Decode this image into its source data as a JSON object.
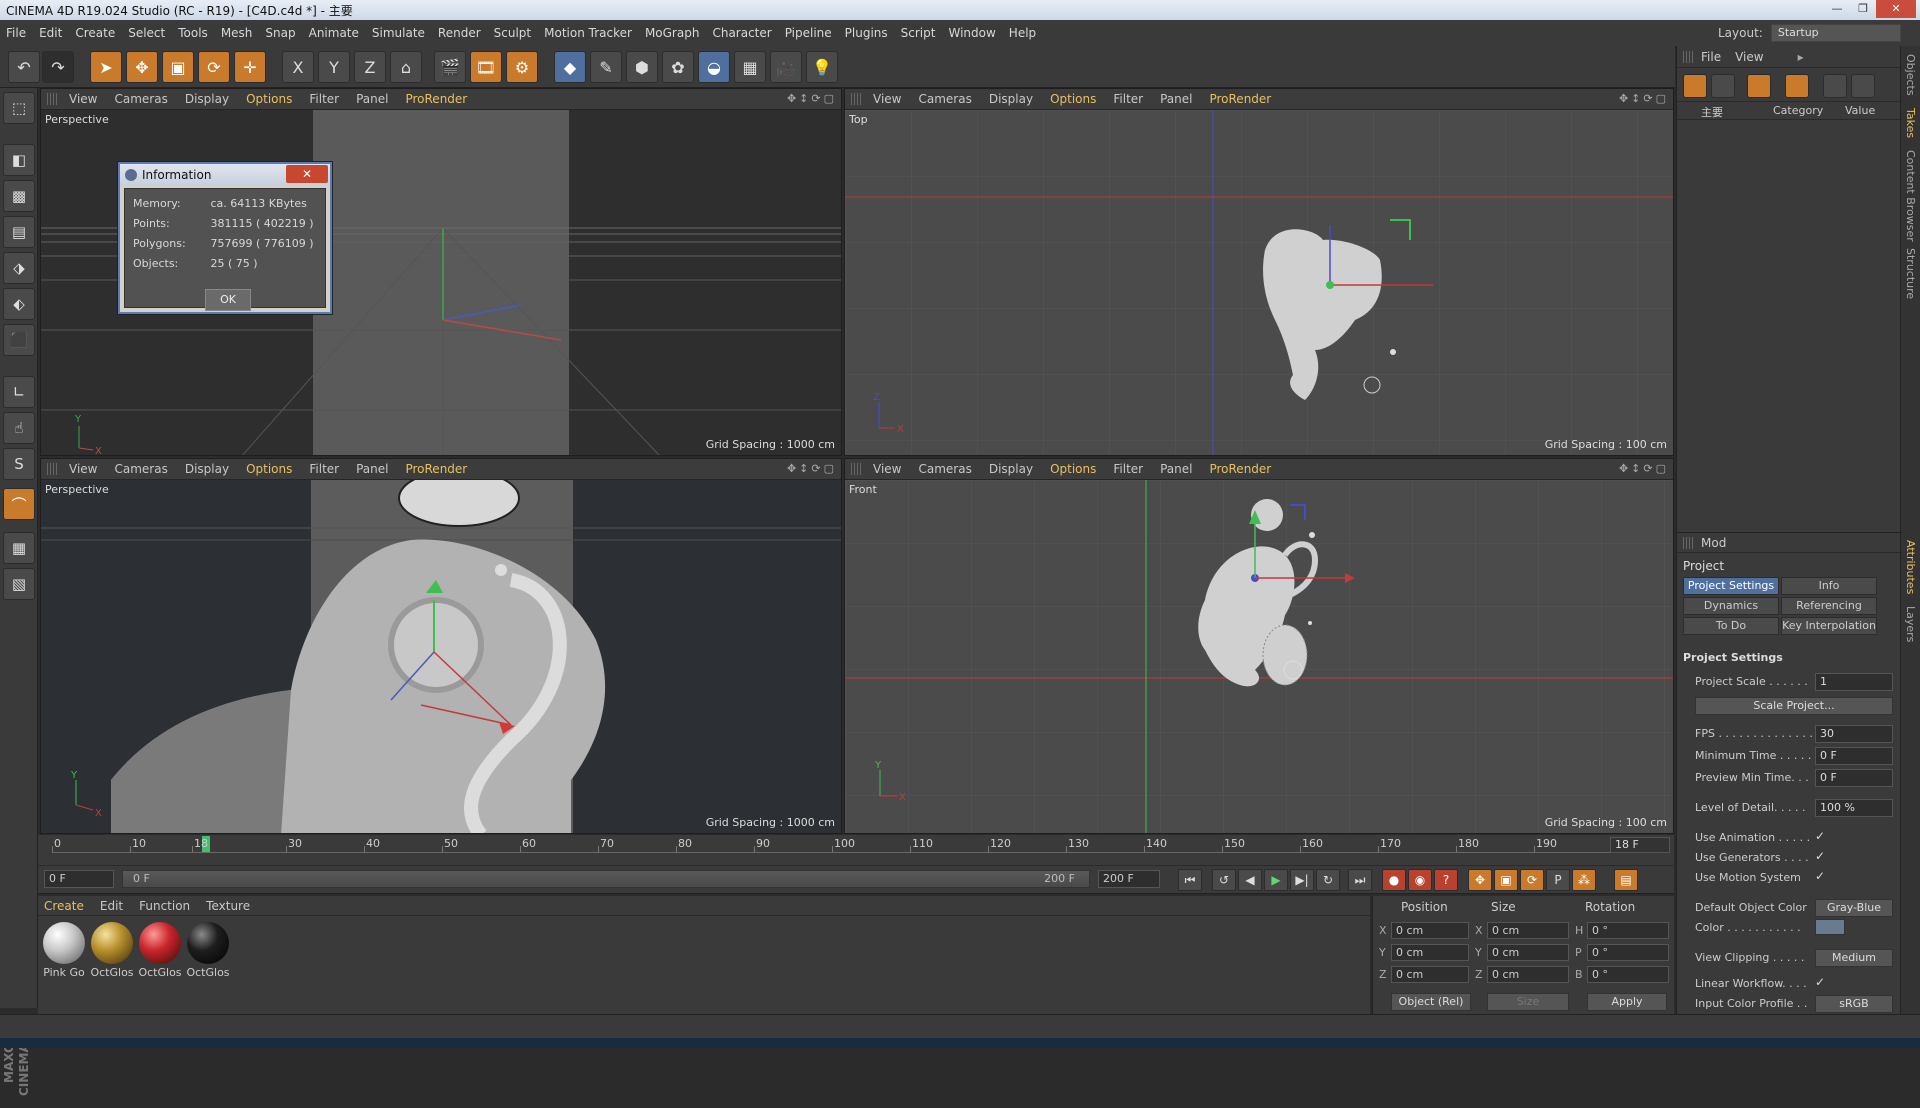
{
  "window": {
    "title": "CINEMA 4D R19.024 Studio (RC - R19) - [C4D.c4d *] - 主要"
  },
  "menu": [
    "File",
    "Edit",
    "Create",
    "Select",
    "Tools",
    "Mesh",
    "Snap",
    "Animate",
    "Simulate",
    "Render",
    "Sculpt",
    "Motion Tracker",
    "MoGraph",
    "Character",
    "Pipeline",
    "Plugins",
    "Script",
    "Window",
    "Help"
  ],
  "layout": {
    "label": "Layout:",
    "value": "Startup"
  },
  "toolbar_axes": {
    "x": "X",
    "y": "Y",
    "z": "Z"
  },
  "viewports": [
    {
      "menu": [
        "View",
        "Cameras",
        "Display",
        "Options",
        "Filter",
        "Panel",
        "ProRender"
      ],
      "label": "Perspective",
      "grid": "Grid Spacing : 1000 cm"
    },
    {
      "menu": [
        "View",
        "Cameras",
        "Display",
        "Options",
        "Filter",
        "Panel",
        "ProRender"
      ],
      "label": "Top",
      "grid": "Grid Spacing : 100 cm"
    },
    {
      "menu": [
        "View",
        "Cameras",
        "Display",
        "Options",
        "Filter",
        "Panel",
        "ProRender"
      ],
      "label": "Perspective",
      "grid": "Grid Spacing : 1000 cm"
    },
    {
      "menu": [
        "View",
        "Cameras",
        "Display",
        "Options",
        "Filter",
        "Panel",
        "ProRender"
      ],
      "label": "Front",
      "grid": "Grid Spacing : 100 cm"
    }
  ],
  "info_dialog": {
    "title": "Information",
    "rows": [
      {
        "key": "Memory:",
        "value": "ca. 64113 KBytes"
      },
      {
        "key": "Points:",
        "value": "381115 ( 402219 )"
      },
      {
        "key": "Polygons:",
        "value": "757699 ( 776109 )"
      },
      {
        "key": "Objects:",
        "value": "25 ( 75 )"
      }
    ],
    "ok": "OK"
  },
  "timeline": {
    "ticks": [
      "0",
      "10",
      "18",
      "30",
      "40",
      "50",
      "60",
      "70",
      "80",
      "90",
      "100",
      "110",
      "120",
      "130",
      "140",
      "150",
      "160",
      "170",
      "180",
      "190",
      "200"
    ],
    "current_frame": "18 F",
    "start_field": "0 F",
    "slider_start": "0 F",
    "slider_end": "200 F",
    "end_field": "200 F"
  },
  "materials": {
    "menu": [
      "Create",
      "Edit",
      "Function",
      "Texture"
    ],
    "items": [
      {
        "name": "Pink Go",
        "color": "#c8c8c8"
      },
      {
        "name": "OctGlos",
        "color": "#b8902c"
      },
      {
        "name": "OctGlos",
        "color": "#c8262a"
      },
      {
        "name": "OctGlos",
        "color": "#1e1e1e"
      }
    ]
  },
  "coordinates": {
    "headers": [
      "Position",
      "Size",
      "Rotation"
    ],
    "rows": [
      {
        "axis": "X",
        "pos": "0 cm",
        "saxis": "X",
        "size": "0 cm",
        "raxis": "H",
        "rot": "0 °"
      },
      {
        "axis": "Y",
        "pos": "0 cm",
        "saxis": "Y",
        "size": "0 cm",
        "raxis": "P",
        "rot": "0 °"
      },
      {
        "axis": "Z",
        "pos": "0 cm",
        "saxis": "Z",
        "size": "0 cm",
        "raxis": "B",
        "rot": "0 °"
      }
    ],
    "mode": "Object (Rel)",
    "size_mode": "Size",
    "apply": "Apply"
  },
  "objects_panel": {
    "menu": [
      "File",
      "View"
    ],
    "tree_item": "主要",
    "columns": [
      "Category",
      "Value"
    ]
  },
  "side_tabs": [
    "Objects",
    "Takes",
    "Content Browser",
    "Structure",
    "Attributes",
    "Layers"
  ],
  "attributes": {
    "mode": "Mod",
    "title": "Project",
    "tabs": [
      "Project Settings",
      "Info",
      "Dynamics",
      "Referencing",
      "To Do",
      "Key Interpolation"
    ],
    "section": "Project Settings",
    "rows": [
      {
        "label": "Project Scale . . . . . .",
        "value": "1"
      },
      {
        "label": "FPS . . . . . . . . . . . . . .",
        "value": "30"
      },
      {
        "label": "Minimum Time . . . . .",
        "value": "0 F"
      },
      {
        "label": "Preview Min Time. . .",
        "value": "0 F"
      },
      {
        "label": "Level of Detail. . . . .",
        "value": "100 %"
      }
    ],
    "scale_button": "Scale Project...",
    "checks": [
      {
        "label": "Use Animation . . . . .",
        "value": "✓"
      },
      {
        "label": "Use Generators . . . .",
        "value": "✓"
      },
      {
        "label": "Use Motion System",
        "value": "✓"
      }
    ],
    "default_color": {
      "label": "Default Object Color",
      "value": "Gray-Blue"
    },
    "color_label": "Color . . . . . . . . . . .",
    "view_clipping": {
      "label": "View Clipping . . . . .",
      "value": "Medium"
    },
    "linear_workflow": {
      "label": "Linear Workflow. . . .",
      "value": "✓"
    },
    "input_profile": {
      "label": "Input Color Profile . .",
      "value": "sRGB"
    }
  }
}
